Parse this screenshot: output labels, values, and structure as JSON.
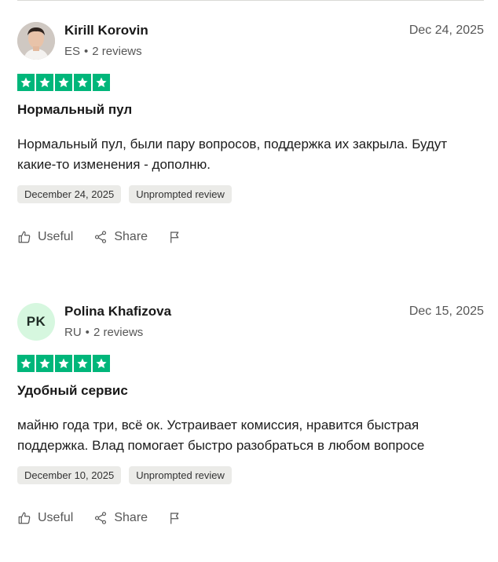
{
  "reviews": [
    {
      "name": "Kirill Korovin",
      "country": "ES",
      "separator": "•",
      "review_count": "2 reviews",
      "date": "Dec 24, 2025",
      "avatar": {
        "type": "photo",
        "icon": "user-photo"
      },
      "rating": 5,
      "title": "Нормальный пул",
      "body": "Нормальный пул, были пару вопросов, поддержка их закрыла. Будут какие-то изменения - дополню.",
      "tags": [
        "December 24, 2025",
        "Unprompted review"
      ],
      "actions": {
        "useful": "Useful",
        "share": "Share"
      }
    },
    {
      "name": "Polina Khafizova",
      "country": "RU",
      "separator": "•",
      "review_count": "2 reviews",
      "date": "Dec 15, 2025",
      "avatar": {
        "type": "initials",
        "initials": "PK",
        "color": "#d6f7df"
      },
      "rating": 5,
      "title": "Удобный сервис",
      "body": "майню года три, всё ок. Устраивает комиссия, нравится быстрая поддержка. Влад помогает быстро разобраться в любом вопросе",
      "tags": [
        "December 10, 2025",
        "Unprompted review"
      ],
      "actions": {
        "useful": "Useful",
        "share": "Share"
      }
    }
  ],
  "colors": {
    "star_green": "#00b67a",
    "tag_bg": "#ebebe8",
    "muted_text": "#575757"
  }
}
